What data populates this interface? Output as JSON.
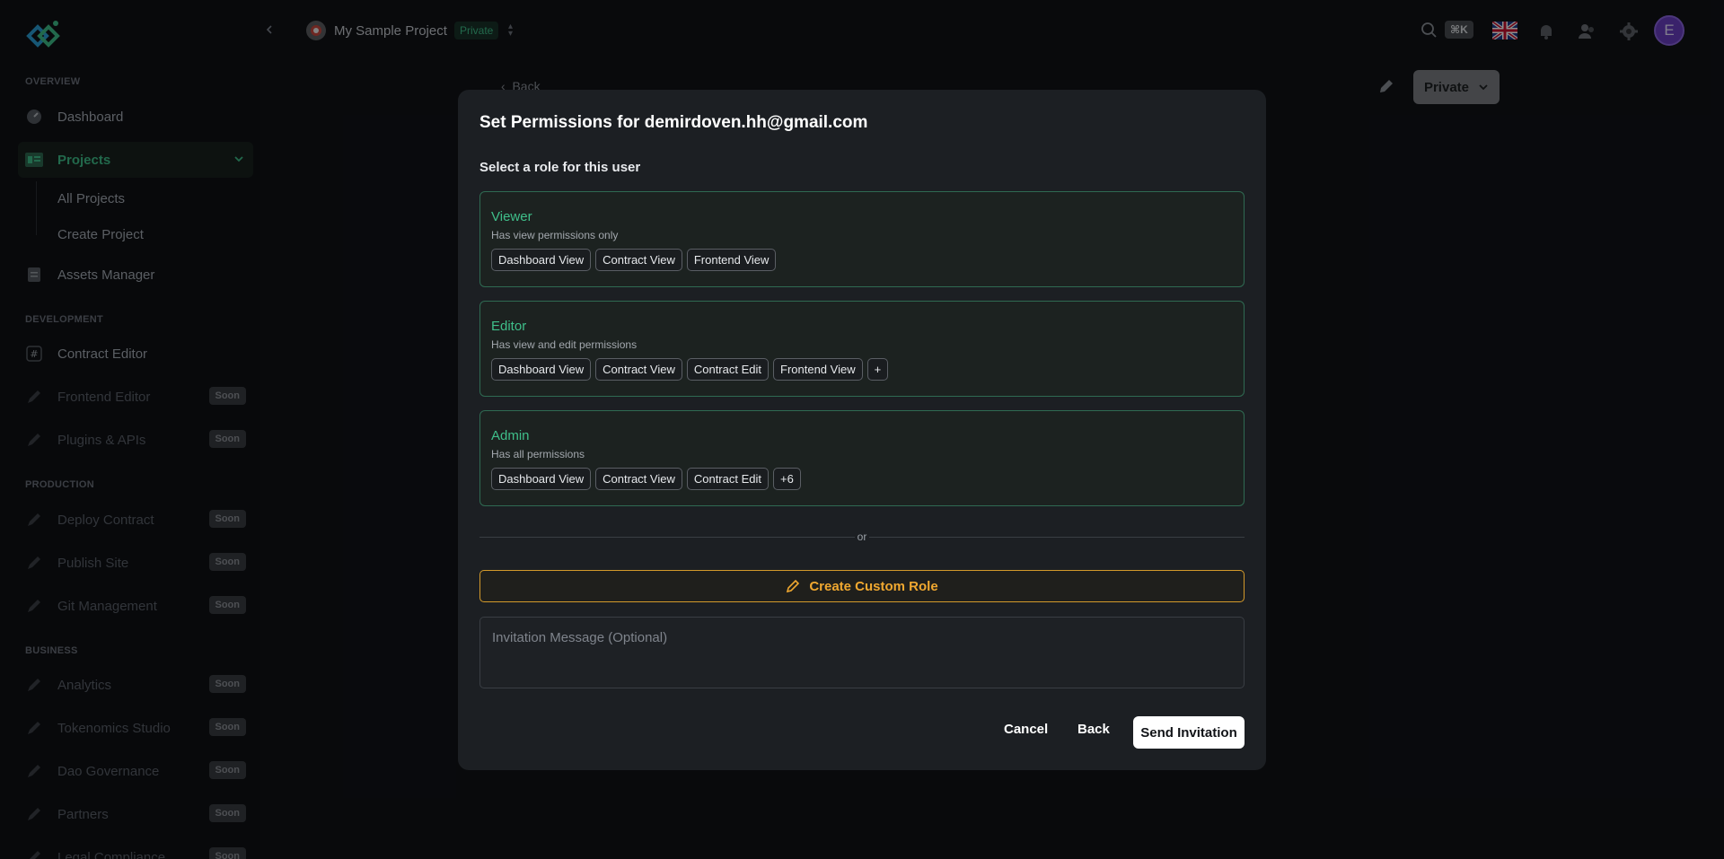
{
  "sidebar": {
    "sections": {
      "overview": "OVERVIEW",
      "development": "DEVELOPMENT",
      "production": "PRODUCTION",
      "business": "BUSINESS"
    },
    "items": {
      "dashboard": "Dashboard",
      "projects": "Projects",
      "all_projects": "All Projects",
      "create_project": "Create Project",
      "assets_manager": "Assets Manager",
      "contract_editor": "Contract Editor",
      "frontend_editor": "Frontend Editor",
      "plugins_apis": "Plugins & APIs",
      "deploy_contract": "Deploy Contract",
      "publish_site": "Publish Site",
      "git_management": "Git Management",
      "analytics": "Analytics",
      "tokenomics_studio": "Tokenomics Studio",
      "dao_governance": "Dao Governance",
      "partners": "Partners",
      "legal_compliance": "Legal Compliance"
    },
    "soon_label": "Soon"
  },
  "topbar": {
    "project_name": "My Sample Project",
    "visibility_badge": "Private",
    "shortcut": "⌘K",
    "user_initial": "E"
  },
  "page": {
    "back_label": "Back",
    "visibility_button": "Private"
  },
  "modal": {
    "title": "Set Permissions for demirdoven.hh@gmail.com",
    "subtitle": "Select a role for this user",
    "roles": [
      {
        "name": "Viewer",
        "description": "Has view permissions only",
        "permissions": [
          "Dashboard View",
          "Contract View",
          "Frontend View"
        ]
      },
      {
        "name": "Editor",
        "description": "Has view and edit permissions",
        "permissions": [
          "Dashboard View",
          "Contract View",
          "Contract Edit",
          "Frontend View",
          "+"
        ]
      },
      {
        "name": "Admin",
        "description": "Has all permissions",
        "permissions": [
          "Dashboard View",
          "Contract View",
          "Contract Edit",
          "+6"
        ]
      }
    ],
    "or_label": "or",
    "custom_role_label": "Create Custom Role",
    "message_placeholder": "Invitation Message (Optional)",
    "cancel_label": "Cancel",
    "back_label": "Back",
    "send_label": "Send Invitation"
  },
  "colors": {
    "accent_green": "#3fbf8a",
    "accent_orange": "#f0a830",
    "background": "#111317",
    "modal": "#1c1f23",
    "avatar": "#6a3fc4"
  }
}
